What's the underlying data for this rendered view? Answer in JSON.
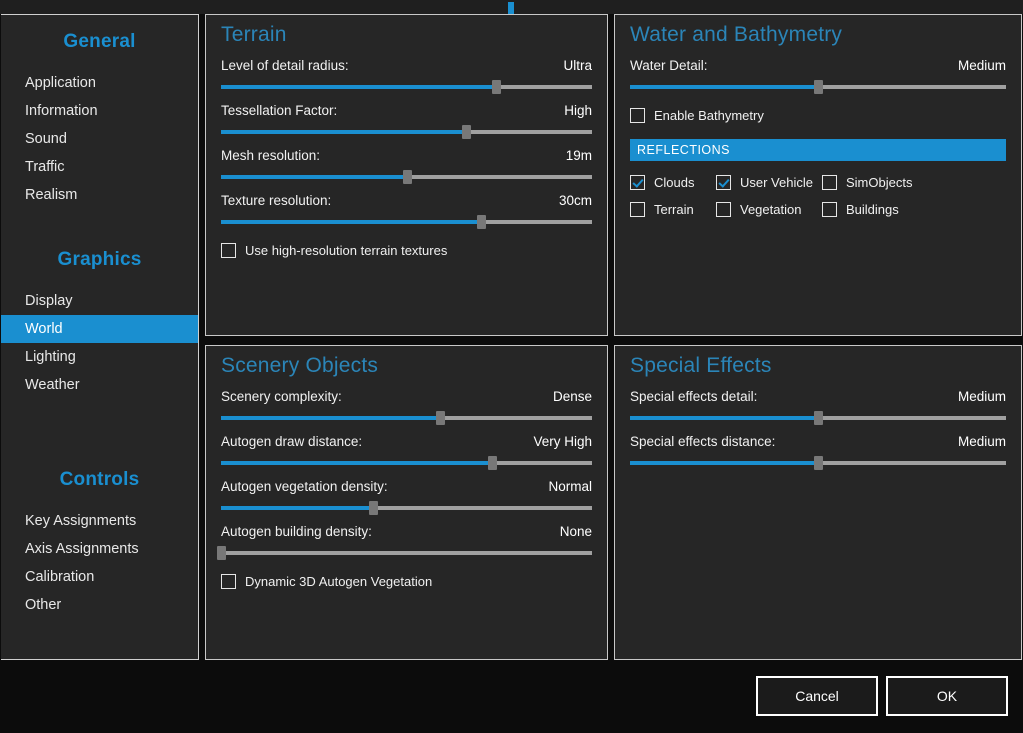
{
  "window": {
    "title_fragment": "|"
  },
  "sidebar": {
    "groups": [
      {
        "title": "General",
        "items": [
          {
            "label": "Application",
            "selected": false
          },
          {
            "label": "Information",
            "selected": false
          },
          {
            "label": "Sound",
            "selected": false
          },
          {
            "label": "Traffic",
            "selected": false
          },
          {
            "label": "Realism",
            "selected": false
          }
        ]
      },
      {
        "title": "Graphics",
        "items": [
          {
            "label": "Display",
            "selected": false
          },
          {
            "label": "World",
            "selected": true
          },
          {
            "label": "Lighting",
            "selected": false
          },
          {
            "label": "Weather",
            "selected": false
          }
        ]
      },
      {
        "title": "Controls",
        "items": [
          {
            "label": "Key Assignments",
            "selected": false
          },
          {
            "label": "Axis Assignments",
            "selected": false
          },
          {
            "label": "Calibration",
            "selected": false
          },
          {
            "label": "Other",
            "selected": false
          }
        ]
      }
    ]
  },
  "panels": {
    "terrain": {
      "title": "Terrain",
      "sliders": [
        {
          "label": "Level of detail radius:",
          "value": "Ultra",
          "percent": 74
        },
        {
          "label": "Tessellation Factor:",
          "value": "High",
          "percent": 66
        },
        {
          "label": "Mesh resolution:",
          "value": "19m",
          "percent": 50
        },
        {
          "label": "Texture resolution:",
          "value": "30cm",
          "percent": 70
        }
      ],
      "checkbox": {
        "label": "Use high-resolution terrain textures",
        "checked": false
      }
    },
    "water": {
      "title": "Water and Bathymetry",
      "sliders": [
        {
          "label": "Water Detail:",
          "value": "Medium",
          "percent": 50
        }
      ],
      "checkbox": {
        "label": "Enable Bathymetry",
        "checked": false
      },
      "reflections": {
        "section_title": "REFLECTIONS",
        "items": [
          {
            "label": "Clouds",
            "checked": true
          },
          {
            "label": "User Vehicle",
            "checked": true
          },
          {
            "label": "SimObjects",
            "checked": false
          },
          {
            "label": "Terrain",
            "checked": false
          },
          {
            "label": "Vegetation",
            "checked": false
          },
          {
            "label": "Buildings",
            "checked": false
          }
        ]
      }
    },
    "scenery": {
      "title": "Scenery Objects",
      "sliders": [
        {
          "label": "Scenery complexity:",
          "value": "Dense",
          "percent": 59
        },
        {
          "label": "Autogen draw distance:",
          "value": "Very High",
          "percent": 73
        },
        {
          "label": "Autogen vegetation density:",
          "value": "Normal",
          "percent": 41
        },
        {
          "label": "Autogen building density:",
          "value": "None",
          "percent": 0
        }
      ],
      "checkbox": {
        "label": "Dynamic 3D Autogen Vegetation",
        "checked": false
      }
    },
    "effects": {
      "title": "Special Effects",
      "sliders": [
        {
          "label": "Special effects detail:",
          "value": "Medium",
          "percent": 50
        },
        {
          "label": "Special effects distance:",
          "value": "Medium",
          "percent": 50
        }
      ]
    }
  },
  "footer": {
    "cancel_label": "Cancel",
    "ok_label": "OK"
  },
  "colors": {
    "accent": "#1a8fd0",
    "panel_title": "#2b85b8",
    "panel_bg": "#262626",
    "page_bg": "#0c0c0c",
    "slider_rail": "#a0a0a0",
    "slider_thumb": "#787878"
  }
}
